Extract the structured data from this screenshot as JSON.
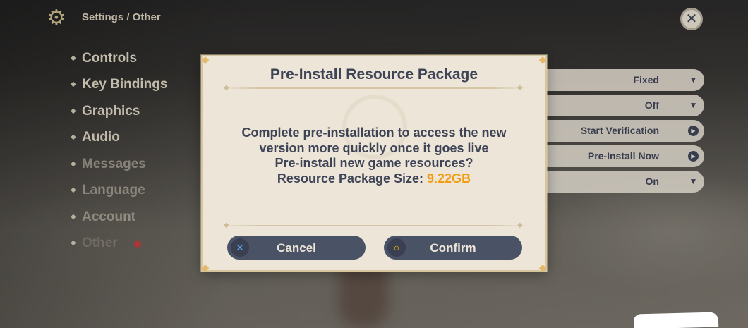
{
  "header": {
    "breadcrumb": "Settings / Other",
    "settings_icon": "gear-icon",
    "close_icon": "close-icon"
  },
  "sidebar": {
    "items": [
      {
        "label": "Controls"
      },
      {
        "label": "Key Bindings"
      },
      {
        "label": "Graphics"
      },
      {
        "label": "Audio"
      },
      {
        "label": "Messages"
      },
      {
        "label": "Language"
      },
      {
        "label": "Account"
      },
      {
        "label": "Other"
      }
    ]
  },
  "options": [
    {
      "value": "Fixed",
      "icon": "dropdown-arrow-icon"
    },
    {
      "value": "Off",
      "icon": "dropdown-arrow-icon"
    },
    {
      "value": "Start Verification",
      "icon": "play-circle-icon"
    },
    {
      "value": "Pre-Install Now",
      "icon": "play-circle-icon"
    },
    {
      "value": "On",
      "icon": "dropdown-arrow-icon"
    }
  ],
  "dialog": {
    "title": "Pre-Install Resource Package",
    "message_line1": "Complete pre-installation to access the new",
    "message_line2": "version more quickly once it goes live",
    "message_line3": "Pre-install new game resources?",
    "size_label": "Resource Package Size: ",
    "size_value": "9.22GB",
    "cancel_label": "Cancel",
    "confirm_label": "Confirm",
    "cancel_icon": "x-button-icon",
    "confirm_icon": "circle-button-icon"
  },
  "colors": {
    "panel": "#ece5d8",
    "text_dark": "#3e4456",
    "button": "#4a5266",
    "accent_size": "#f39c12",
    "cancel_icon": "#5aa7e4",
    "confirm_icon": "#f2c300"
  }
}
